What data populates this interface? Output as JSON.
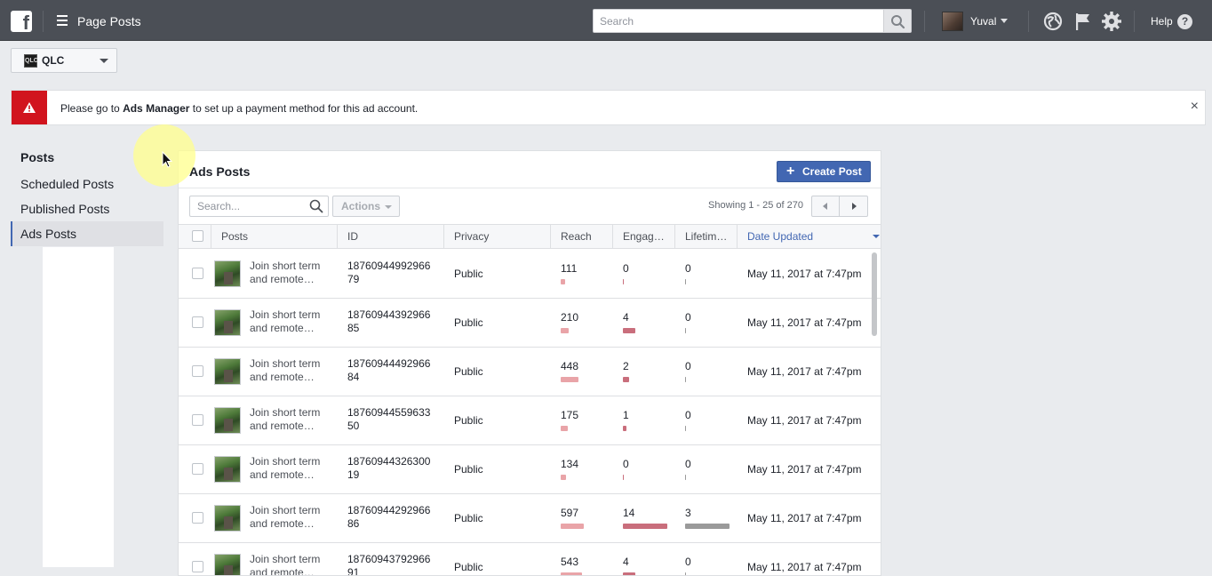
{
  "topbar": {
    "page_title": "Page Posts",
    "search_placeholder": "Search",
    "user_name": "Yuval",
    "help_label": "Help",
    "help_icon_glyph": "?",
    "icons": [
      "facebook-logo-icon",
      "hamburger-menu-icon",
      "search-icon",
      "globe-icon",
      "flag-icon",
      "gear-icon",
      "help-icon"
    ]
  },
  "account": {
    "name": "QLC",
    "logo_text": "QLC"
  },
  "alert": {
    "text_before": "Please go to ",
    "link": "Ads Manager",
    "text_after": " to set up a payment method for this ad account.",
    "close_glyph": "×",
    "color": "#d1141e"
  },
  "nav": {
    "heading": "Posts",
    "items": [
      {
        "label": "Scheduled Posts"
      },
      {
        "label": "Published Posts"
      },
      {
        "label": "Ads Posts"
      }
    ],
    "active_item": "Ads Posts"
  },
  "panel": {
    "title": "Ads Posts",
    "create_button": "Create Post",
    "create_glyph": "+",
    "search_placeholder": "Search...",
    "actions_label": "Actions",
    "showing": "Showing 1 - 25 of 270",
    "accent_color": "#4267b2"
  },
  "table": {
    "columns": [
      "Posts",
      "ID",
      "Privacy",
      "Reach",
      "Engag…",
      "Lifetim…",
      "Date Updated"
    ],
    "sorted_column": "Date Updated",
    "rows": [
      {
        "post_line1": "Join short term",
        "post_line2": "and remote…",
        "id_line1": "18760944992966",
        "id_line2": "79",
        "privacy": "Public",
        "reach": 111,
        "engagement": 0,
        "lifetime": 0,
        "date": "May 11, 2017 at 7:47pm"
      },
      {
        "post_line1": "Join short term",
        "post_line2": "and remote…",
        "id_line1": "18760944392966",
        "id_line2": "85",
        "privacy": "Public",
        "reach": 210,
        "engagement": 4,
        "lifetime": 0,
        "date": "May 11, 2017 at 7:47pm"
      },
      {
        "post_line1": "Join short term",
        "post_line2": "and remote…",
        "id_line1": "18760944492966",
        "id_line2": "84",
        "privacy": "Public",
        "reach": 448,
        "engagement": 2,
        "lifetime": 0,
        "date": "May 11, 2017 at 7:47pm"
      },
      {
        "post_line1": "Join short term",
        "post_line2": "and remote…",
        "id_line1": "18760944559633",
        "id_line2": "50",
        "privacy": "Public",
        "reach": 175,
        "engagement": 1,
        "lifetime": 0,
        "date": "May 11, 2017 at 7:47pm"
      },
      {
        "post_line1": "Join short term",
        "post_line2": "and remote…",
        "id_line1": "18760944326300",
        "id_line2": "19",
        "privacy": "Public",
        "reach": 134,
        "engagement": 0,
        "lifetime": 0,
        "date": "May 11, 2017 at 7:47pm"
      },
      {
        "post_line1": "Join short term",
        "post_line2": "and remote…",
        "id_line1": "18760944292966",
        "id_line2": "86",
        "privacy": "Public",
        "reach": 597,
        "engagement": 14,
        "lifetime": 3,
        "date": "May 11, 2017 at 7:47pm"
      },
      {
        "post_line1": "Join short term",
        "post_line2": "and remote…",
        "id_line1": "18760943792966",
        "id_line2": "91",
        "privacy": "Public",
        "reach": 543,
        "engagement": 4,
        "lifetime": 0,
        "date": "May 11, 2017 at 7:47pm"
      }
    ]
  }
}
